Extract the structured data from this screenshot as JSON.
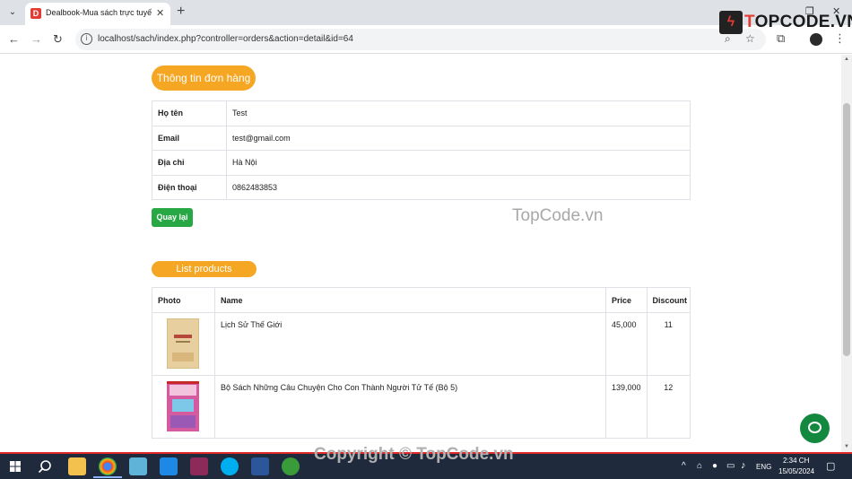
{
  "browser": {
    "tab_title": "Dealbook-Mua sách trực tuyến",
    "tab_favicon": "D",
    "url": "localhost/sach/index.php?controller=orders&action=detail&id=64"
  },
  "overlay": {
    "logo_text": "TOPCODE.VN",
    "watermark": "TopCode.vn",
    "copyright": "Copyright © TopCode.vn"
  },
  "order_info": {
    "heading": "Thông tin đơn hàng",
    "rows": [
      {
        "label": "Họ tên",
        "value": "Test"
      },
      {
        "label": "Email",
        "value": "test@gmail.com"
      },
      {
        "label": "Địa chỉ",
        "value": "Hà Nội"
      },
      {
        "label": "Điện thoại",
        "value": "0862483853"
      }
    ],
    "back_label": "Quay lại"
  },
  "products": {
    "heading": "List products",
    "columns": [
      "Photo",
      "Name",
      "Price",
      "Discount"
    ],
    "rows": [
      {
        "name": "Lịch Sử Thế Giới",
        "price": "45,000",
        "discount": "11"
      },
      {
        "name": "Bộ Sách Những Câu Chuyện Cho Con Thành Người Tử Tế (Bộ 5)",
        "price": "139,000",
        "discount": "12"
      }
    ]
  },
  "taskbar": {
    "language": "ENG",
    "time": "2:34 CH",
    "date": "15/05/2024"
  },
  "colors": {
    "accent_orange": "#f5a623",
    "button_green": "#28a745",
    "chat_green": "#13883f"
  }
}
